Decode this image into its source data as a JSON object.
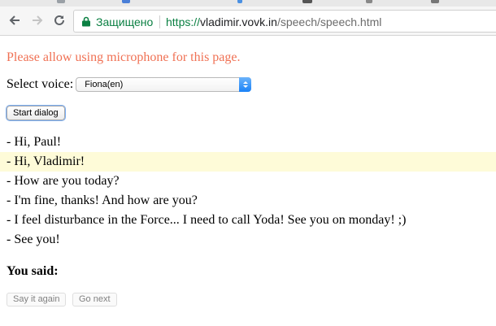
{
  "browser": {
    "security_label": "Защищено",
    "url_scheme": "https://",
    "url_host": "vladimir.vovk.in",
    "url_path": "/speech/speech.html"
  },
  "page": {
    "mic_warning": "Please allow using microphone for this page.",
    "voice_label": "Select voice:",
    "voice_selected": "Fiona(en)",
    "start_button": "Start dialog",
    "dialog": [
      "- Hi, Paul!",
      "- Hi, Vladimir!",
      "- How are you today?",
      "- I'm fine, thanks! And how are you?",
      "- I feel disturbance in the Force... I need to call Yoda! See you on monday! ;)",
      "- See you!"
    ],
    "you_said_label": "You said:",
    "say_again_button": "Say it again",
    "go_next_button": "Go next"
  },
  "colors": {
    "warning_text": "#f07154",
    "secure_green": "#0b8043",
    "highlight_line": "#fefbd8",
    "select_accent": "#1a82f7"
  }
}
